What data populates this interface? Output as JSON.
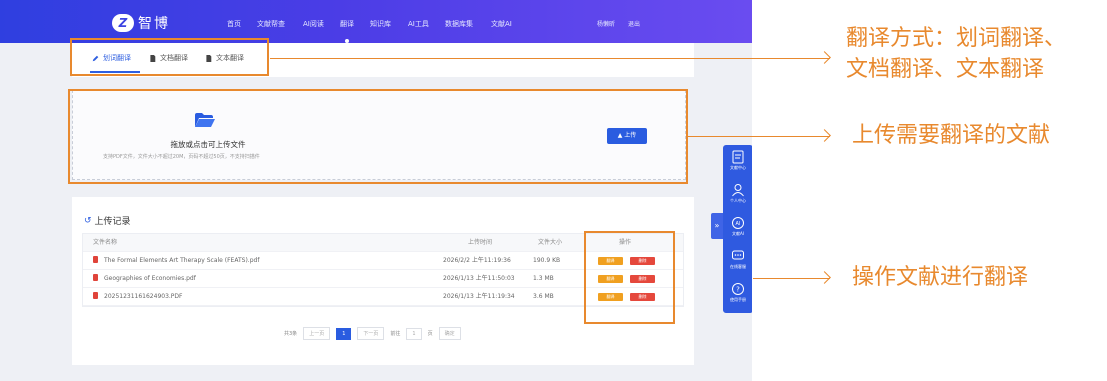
{
  "header": {
    "logo_mark": "Z",
    "logo_text": "智博",
    "nav": [
      "首页",
      "文献帮查",
      "AI阅读",
      "翻译",
      "知识库",
      "AI工具",
      "数据库集",
      "文献AI"
    ],
    "user": "杨懒昕",
    "logout": "退出"
  },
  "tabs": [
    "划词翻译",
    "文档翻译",
    "文本翻译"
  ],
  "upload": {
    "title": "拖放或点击可上传文件",
    "note": "支持PDF文件，文件大小不超过20M，页码不超过50页，不支持扫描件",
    "button": "上传"
  },
  "records": {
    "title": "上传记录",
    "columns": [
      "文件名称",
      "上传时间",
      "文件大小",
      "操作"
    ],
    "rows": [
      {
        "name": "The Formal Elements Art Therapy Scale (FEATS).pdf",
        "time": "2026/2/2 上午11:19:36",
        "size": "190.9 KB"
      },
      {
        "name": "Geographies of Economies.pdf",
        "time": "2026/1/13 上午11:50:03",
        "size": "1.3 MB"
      },
      {
        "name": "20251231161624903.PDF",
        "time": "2026/1/13 上午11:19:34",
        "size": "3.6 MB"
      }
    ],
    "translate_btn": "翻译",
    "delete_btn": "删除"
  },
  "pager": {
    "total": "共3条",
    "prev": "上一页",
    "current": "1",
    "next": "下一页",
    "goto": "前往",
    "page_input": "1",
    "page_unit": "页",
    "confirm": "确定"
  },
  "sidebar": {
    "toggle": "»",
    "items": [
      "文献中心",
      "个人中心",
      "文献AI",
      "在线客服",
      "使用手册"
    ]
  },
  "annotations": [
    {
      "lines": [
        "翻译方式：划词翻译、",
        "文档翻译、文本翻译"
      ]
    },
    {
      "lines": [
        "上传需要翻译的文献"
      ]
    },
    {
      "lines": [
        "操作文献进行翻译"
      ]
    }
  ],
  "colors": {
    "accent": "#e8892e",
    "primary": "#2a5ce0",
    "warning": "#f0a020",
    "danger": "#e5483c"
  }
}
